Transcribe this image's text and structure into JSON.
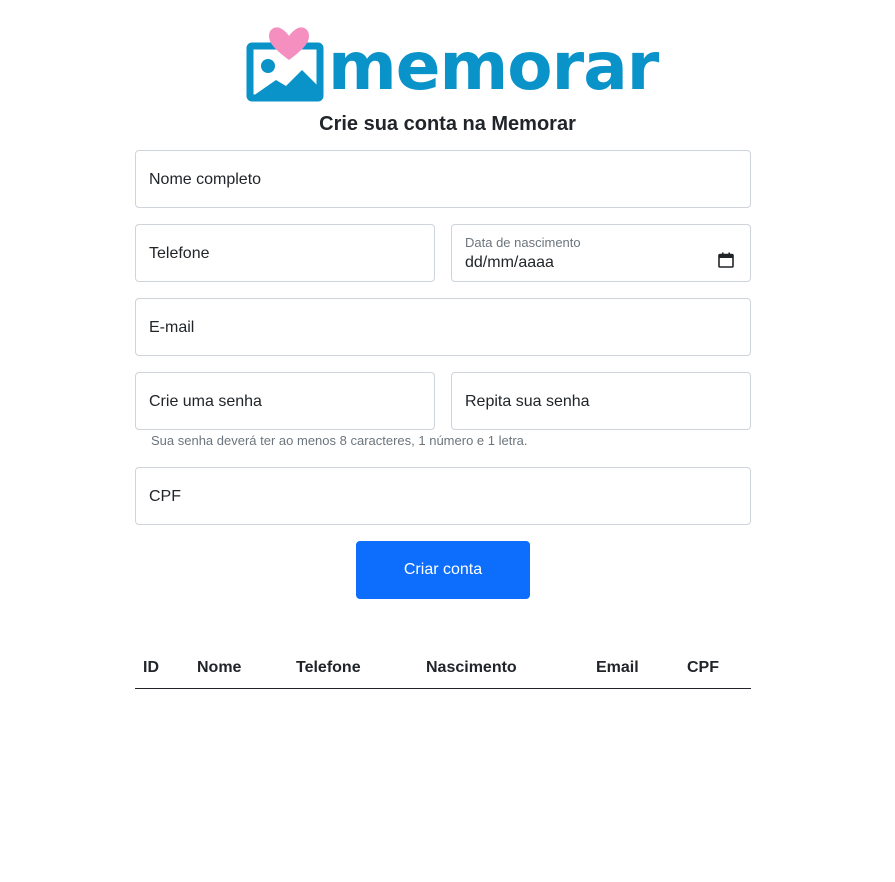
{
  "brand": {
    "logo_text": "memorar",
    "logo_color": "#0a93c9",
    "heart_color": "#f48fc0"
  },
  "page_title": "Crie sua conta na Memorar",
  "form": {
    "full_name": {
      "placeholder": "Nome completo"
    },
    "phone": {
      "placeholder": "Telefone"
    },
    "birth_date": {
      "label": "Data de nascimento",
      "value": "dd/mm/aaaa"
    },
    "email": {
      "placeholder": "E-mail"
    },
    "password": {
      "placeholder": "Crie uma senha"
    },
    "password_repeat": {
      "placeholder": "Repita sua senha"
    },
    "password_hint": "Sua senha deverá ter ao menos 8 caracteres, 1 número e 1 letra.",
    "cpf": {
      "placeholder": "CPF"
    },
    "submit_label": "Criar conta",
    "accent_color": "#0d6efd"
  },
  "table": {
    "columns": [
      "ID",
      "Nome",
      "Telefone",
      "Nascimento",
      "Email",
      "CPF"
    ],
    "rows": []
  }
}
